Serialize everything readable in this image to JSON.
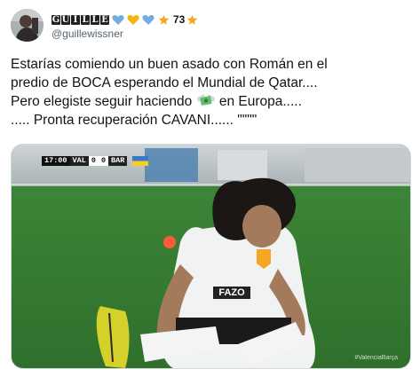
{
  "tweet": {
    "display_name_letters": [
      "G",
      "U",
      "I",
      "L",
      "L",
      "E"
    ],
    "badge_count": "73",
    "handle": "@guillewissner",
    "icons": [
      "light-blue-heart-icon",
      "yellow-heart-icon",
      "light-blue-heart-icon",
      "star-icon",
      "star-icon",
      "money-with-wings-icon"
    ],
    "colors": {
      "light_blue": "#74acdf",
      "yellow": "#f6b40e",
      "star": "#f5a623",
      "handle_gray": "#536471"
    },
    "text": {
      "line1": "Estarías comiendo un buen asado con Román en el",
      "line2": "predio de BOCA esperando el Mundial de Qatar....",
      "line3_a": "Pero elegiste seguir haciendo",
      "line3_b": " en Europa.....",
      "line4": "..... Pronta recuperación CAVANI...... \"\"\"\""
    }
  },
  "media": {
    "scorebug": {
      "time": "17:00",
      "home": "VAL",
      "home_score": "0",
      "away_score": "0",
      "away": "BAR"
    },
    "sponsor_text": "FAZO",
    "watermark": "#ValenciaBarça"
  }
}
